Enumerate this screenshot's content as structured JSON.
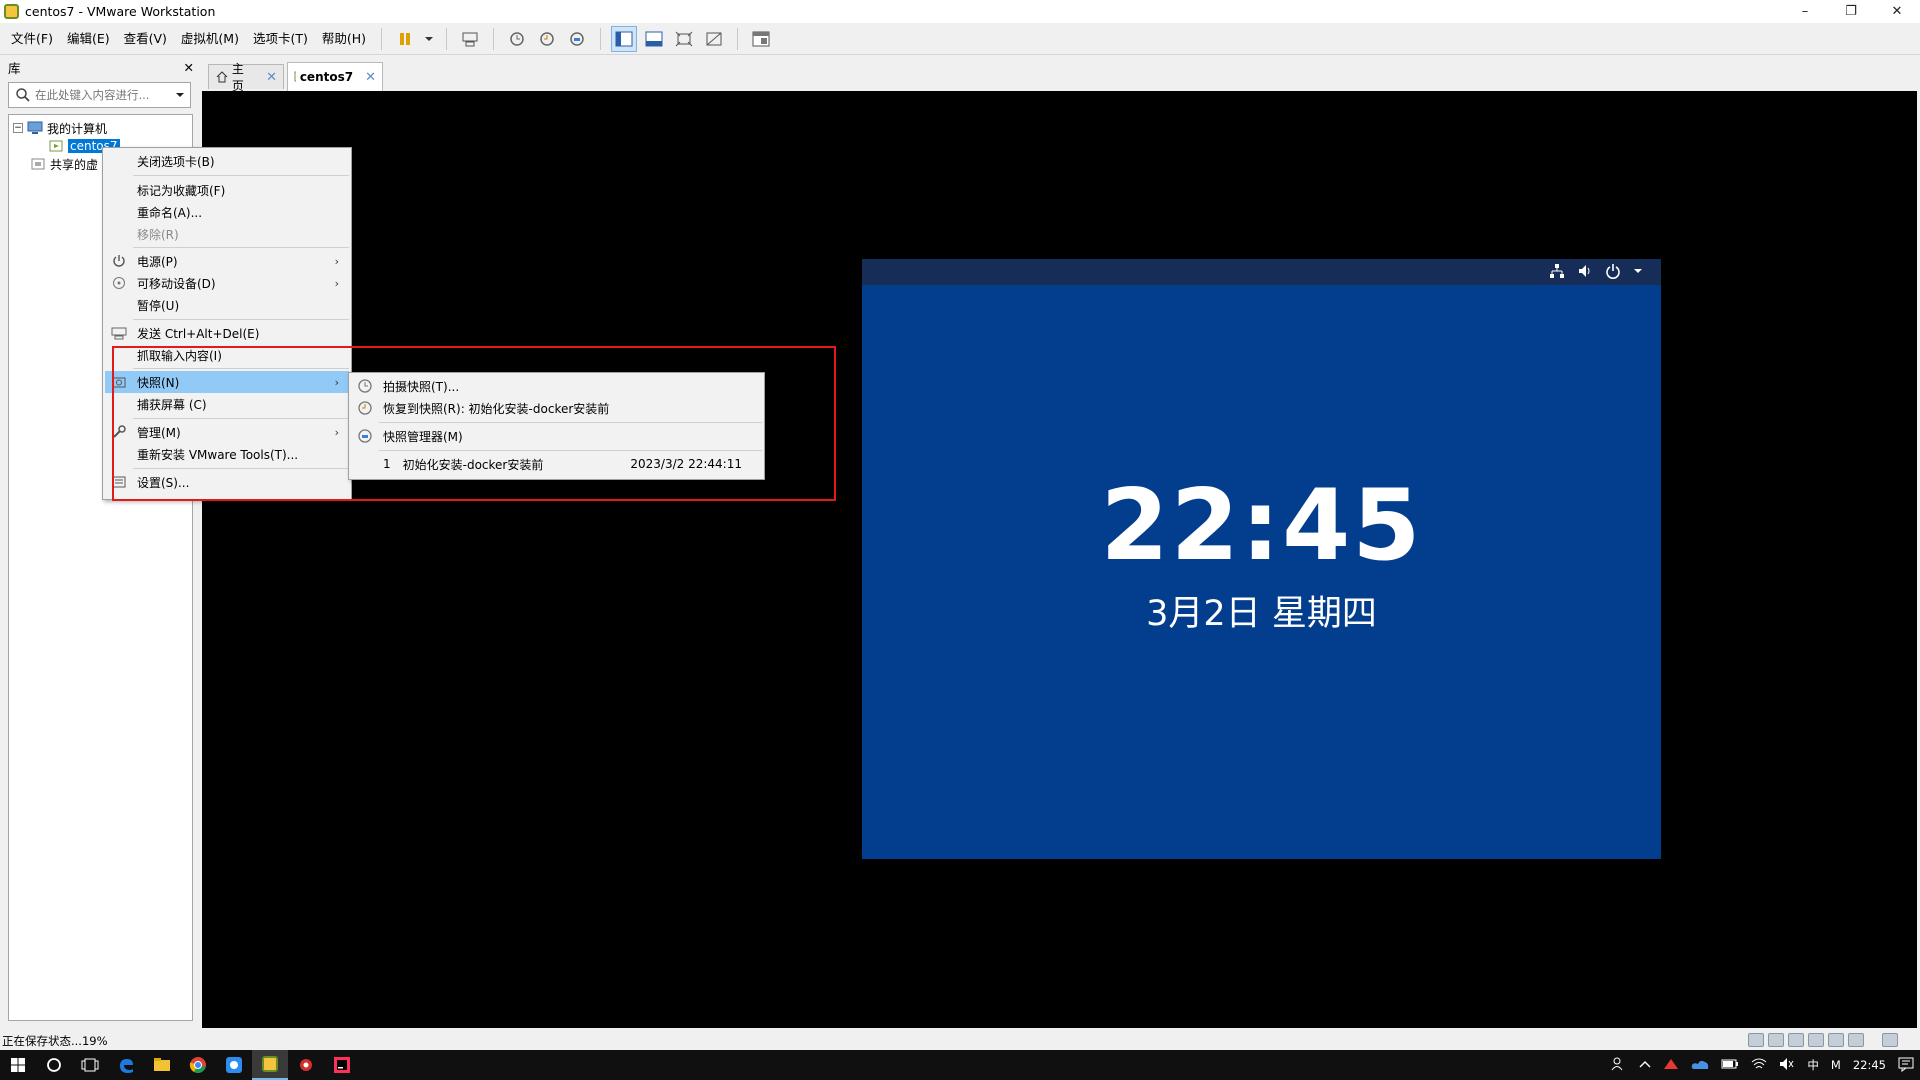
{
  "window": {
    "title": "centos7 - VMware Workstation",
    "minimize": "–",
    "restore": "❐",
    "close": "✕"
  },
  "menu": [
    "文件(F)",
    "编辑(E)",
    "查看(V)",
    "虚拟机(M)",
    "选项卡(T)",
    "帮助(H)"
  ],
  "library": {
    "header": "库",
    "close": "✕",
    "search_placeholder": "在此处键入内容进行...",
    "tree": {
      "root_expander": "−",
      "root": "我的计算机",
      "vm": "centos7",
      "shared": "共享的虚"
    }
  },
  "tabs": {
    "home": "主页",
    "vm": "centos7",
    "close": "✕"
  },
  "vm_screen": {
    "time": "22:45",
    "date": "3月2日 星期四"
  },
  "context_menu": {
    "items": {
      "close_tab": "关闭选项卡(B)",
      "favorite": "标记为收藏项(F)",
      "rename": "重命名(A)...",
      "remove": "移除(R)",
      "power": "电源(P)",
      "removable": "可移动设备(D)",
      "pause": "暂停(U)",
      "send_cad": "发送 Ctrl+Alt+Del(E)",
      "grab_input": "抓取输入内容(I)",
      "snapshot": "快照(N)",
      "capture_screen": "捕获屏幕 (C)",
      "manage": "管理(M)",
      "reinstall_tools": "重新安装 VMware Tools(T)...",
      "settings": "设置(S)..."
    },
    "arrow": "›"
  },
  "snapshot_submenu": {
    "take": "拍摄快照(T)...",
    "revert": "恢复到快照(R): 初始化安装-docker安装前",
    "manager": "快照管理器(M)",
    "entry_index": "1",
    "entry_name": "初始化安装-docker安装前",
    "entry_time": "2023/3/2 22:44:11"
  },
  "status": {
    "message": "正在保存状态...19%"
  },
  "taskbar": {
    "time": "22:45",
    "ime": "中",
    "m": "M"
  },
  "colors": {
    "vm_bg": "#033d8e",
    "highlight": "#91c9f7",
    "annotation": "#e01b1b",
    "selection": "#0078d7"
  }
}
